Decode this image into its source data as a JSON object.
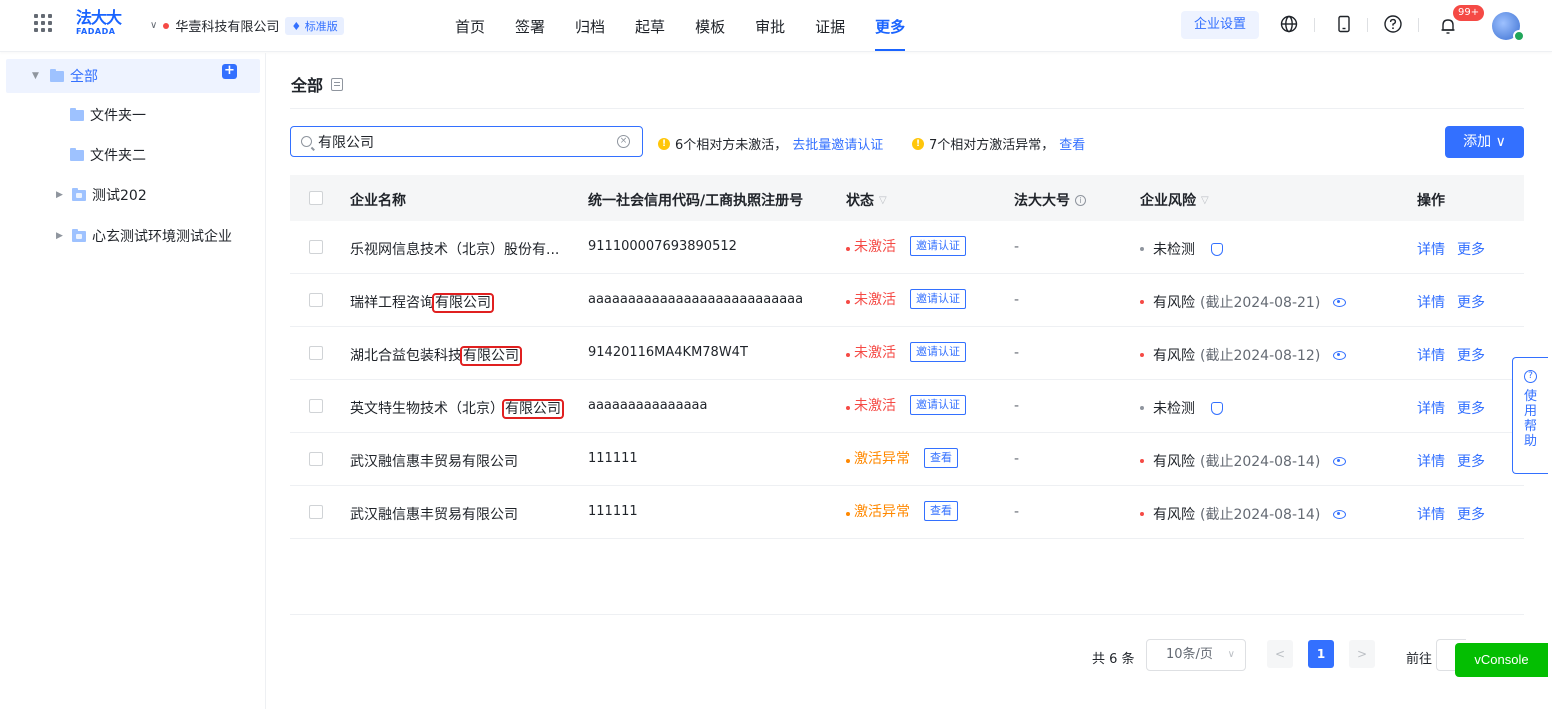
{
  "header": {
    "logo_cn": "法大大",
    "logo_en": "FADADA",
    "company_name": "华壹科技有限公司",
    "edition_badge": "标准版",
    "nav": [
      "首页",
      "签署",
      "归档",
      "起草",
      "模板",
      "审批",
      "证据",
      "更多"
    ],
    "active_nav_index": 7,
    "enterprise_settings": "企业设置",
    "notification_count": "99+"
  },
  "sidebar": {
    "root_label": "全部",
    "items": [
      {
        "label": "文件夹一",
        "type": "folder",
        "expandable": false
      },
      {
        "label": "文件夹二",
        "type": "folder",
        "expandable": false
      },
      {
        "label": "测试202",
        "type": "shared-folder",
        "expandable": true
      },
      {
        "label": "心玄测试环境测试企业",
        "type": "shared-folder",
        "expandable": true
      }
    ]
  },
  "main": {
    "title": "全部",
    "search": {
      "value": "有限公司"
    },
    "notice1_text": "6个相对方未激活，",
    "notice1_link": "去批量邀请认证",
    "notice2_text": "7个相对方激活异常，",
    "notice2_link": "查看",
    "add_button": "添加 ∨"
  },
  "table": {
    "headers": {
      "name": "企业名称",
      "code": "统一社会信用代码/工商执照注册号",
      "status": "状态",
      "fadada_no": "法大大号",
      "risk": "企业风险",
      "ops": "操作"
    },
    "rows": [
      {
        "name_pre": "乐视网信息技术（北京）股份有...",
        "name_hl": "",
        "name_post": "",
        "code": "911100007693890512",
        "status": "未激活",
        "status_color": "#f54a45",
        "status_action": "邀请认证",
        "fadada_no": "-",
        "risk": "未检测",
        "risk_color": "#8f959e",
        "risk_note": "",
        "risk_icon": "shield-icon",
        "op1": "详情",
        "op2": "更多"
      },
      {
        "name_pre": "瑞祥工程咨询",
        "name_hl": "有限公司",
        "name_post": "",
        "code": "aaaaaaaaaaaaaaaaaaaaaaaaaaa",
        "status": "未激活",
        "status_color": "#f54a45",
        "status_action": "邀请认证",
        "fadada_no": "-",
        "risk": "有风险",
        "risk_color": "#f54a45",
        "risk_note": "(截止2024-08-21)",
        "risk_icon": "eye-icon",
        "op1": "详情",
        "op2": "更多"
      },
      {
        "name_pre": "湖北合益包装科技",
        "name_hl": "有限公司",
        "name_post": "",
        "code": "91420116MA4KM78W4T",
        "status": "未激活",
        "status_color": "#f54a45",
        "status_action": "邀请认证",
        "fadada_no": "-",
        "risk": "有风险",
        "risk_color": "#f54a45",
        "risk_note": "(截止2024-08-12)",
        "risk_icon": "eye-icon",
        "op1": "详情",
        "op2": "更多"
      },
      {
        "name_pre": "英文特生物技术（北京）",
        "name_hl": "有限公司",
        "name_post": "",
        "code": "aaaaaaaaaaaaaaa",
        "status": "未激活",
        "status_color": "#f54a45",
        "status_action": "邀请认证",
        "fadada_no": "-",
        "risk": "未检测",
        "risk_color": "#8f959e",
        "risk_note": "",
        "risk_icon": "shield-icon",
        "op1": "详情",
        "op2": "更多"
      },
      {
        "name_pre": "武汉融信惠丰贸易有限公司",
        "name_hl": "",
        "name_post": "",
        "code": "111111",
        "status": "激活异常",
        "status_color": "#ff8800",
        "status_action": "查看",
        "fadada_no": "-",
        "risk": "有风险",
        "risk_color": "#f54a45",
        "risk_note": "(截止2024-08-14)",
        "risk_icon": "eye-icon",
        "op1": "详情",
        "op2": "更多"
      },
      {
        "name_pre": "武汉融信惠丰贸易有限公司",
        "name_hl": "",
        "name_post": "",
        "code": "111111",
        "status": "激活异常",
        "status_color": "#ff8800",
        "status_action": "查看",
        "fadada_no": "-",
        "risk": "有风险",
        "risk_color": "#f54a45",
        "risk_note": "(截止2024-08-14)",
        "risk_icon": "eye-icon",
        "op1": "详情",
        "op2": "更多"
      }
    ]
  },
  "help_tab": {
    "chars": [
      "使",
      "用",
      "帮",
      "助"
    ]
  },
  "pagination": {
    "total": "共 6 条",
    "page_size": "10条/页",
    "current_page": "1",
    "goto_label": "前往"
  },
  "vconsole_label": "vConsole"
}
